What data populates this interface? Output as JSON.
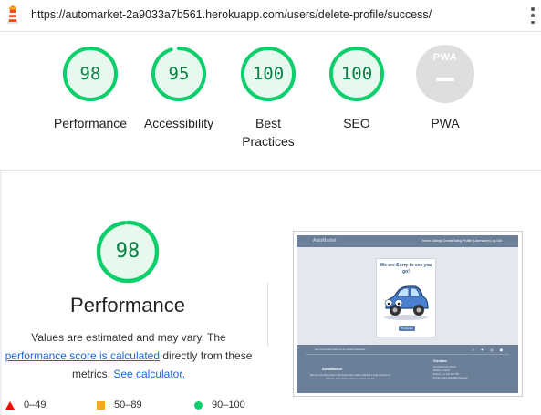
{
  "browser": {
    "url": "https://automarket-2a9033a7b561.herokuapp.com/users/delete-profile/success/"
  },
  "summary": {
    "gauges": [
      {
        "label": "Performance",
        "score": 98
      },
      {
        "label": "Accessibility",
        "score": 95
      },
      {
        "label": "Best Practices",
        "score": 100
      },
      {
        "label": "SEO",
        "score": 100
      }
    ],
    "pwa": {
      "label": "PWA",
      "badge": "PWA"
    }
  },
  "performance": {
    "score": 98,
    "title": "Performance",
    "desc_pre": "Values are estimated and may vary. The ",
    "desc_link": "performance score is calculated",
    "desc_mid": " directly from these metrics. ",
    "desc_link2": "See calculator."
  },
  "legend": {
    "fail": "0–49",
    "average": "50–89",
    "pass": "90–100"
  },
  "colors": {
    "pass": "#0cce6b",
    "pass_text": "#0b8043",
    "average": "#fba51d",
    "fail": "#eb0f00",
    "link": "#1967d2"
  },
  "screenshot": {
    "brand": "AutoMarket",
    "nav_links": "Home   Listings   Create listing   Profile (Username)   Log Out",
    "card_title": "We are Sorry to see you go!",
    "button": "To Home",
    "footer_note": "Get connected with us on social networks:",
    "footer_heading": "AutoMarket",
    "footer_contact_heading": "Contact",
    "footer_text": "Discover the best deals in the automotive market. Explore a wide selection of vehicles, from trusted sellers to private owners.",
    "contact_lines": [
      "43 Hollywood Street",
      "Dublin, Ireland",
      "Phone: +1 234 567 88",
      "Email: automarket@gmail.com"
    ]
  }
}
